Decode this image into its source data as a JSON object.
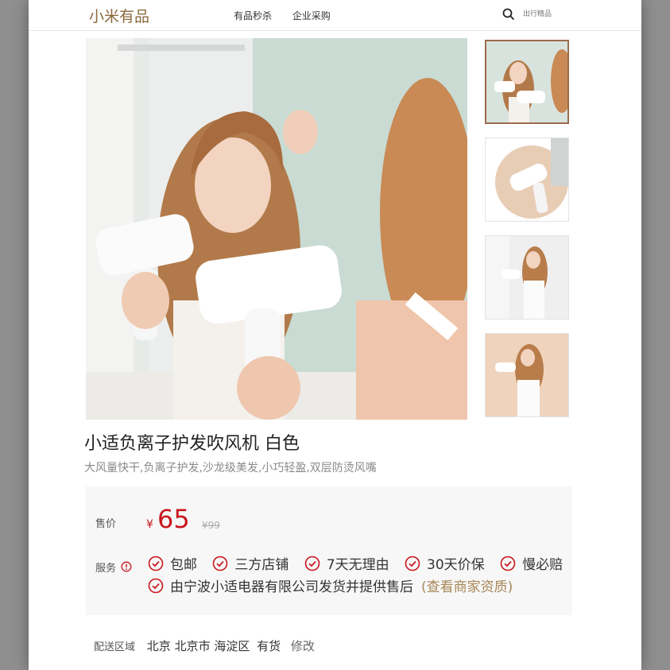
{
  "header": {
    "logo": "小米有品",
    "nav": [
      "有品秒杀",
      "企业采购"
    ],
    "search_placeholder": "出行精品"
  },
  "product": {
    "title": "小适负离子护发吹风机 白色",
    "subtitle": "大风量快干,负离子护发,沙龙级美发,小巧轻盈,双层防烫风嘴",
    "price_label": "售价",
    "currency": "¥",
    "price": "65",
    "original_price": "¥99",
    "service_label": "服务",
    "services": [
      "包邮",
      "三方店铺",
      "7天无理由",
      "30天价保",
      "慢必赔"
    ],
    "shipper_note": "由宁波小适电器有限公司发货并提供售后",
    "merchant_link": "(查看商家资质)"
  },
  "delivery": {
    "label": "配送区域",
    "address": "北京 北京市 海淀区",
    "stock": "有货",
    "edit": "修改"
  },
  "colors": {
    "brand": "#8a6a3c",
    "price_red": "#c8161d",
    "link_gold": "#a78657"
  }
}
